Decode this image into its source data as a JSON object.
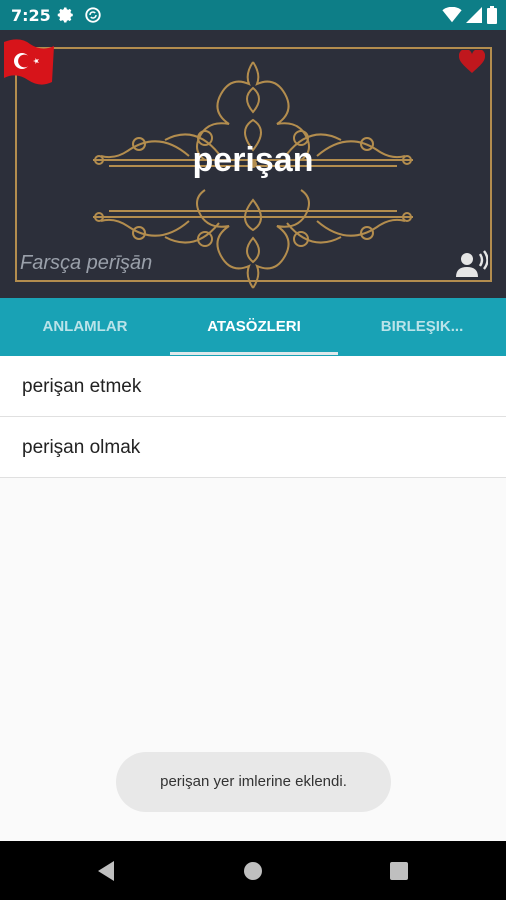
{
  "status_bar": {
    "time": "7:25"
  },
  "header": {
    "word": "perişan",
    "origin": "Farsça perīşān",
    "colors": {
      "background": "#2c2f3a",
      "gold": "#b38d4e",
      "heart": "#c0171d"
    }
  },
  "tabs": [
    {
      "label": "ANLAMLAR",
      "active": false
    },
    {
      "label": "ATASÖZLERI",
      "active": true
    },
    {
      "label": "BIRLEŞIK...",
      "active": false
    }
  ],
  "list": [
    {
      "text": "perişan etmek"
    },
    {
      "text": "perişan olmak"
    }
  ],
  "toast": {
    "text": "perişan yer imlerine eklendi."
  },
  "icons": {
    "status": [
      "gear-icon",
      "sync-icon",
      "wifi-icon",
      "signal-icon",
      "battery-icon"
    ],
    "header": [
      "turkish-flag-icon",
      "heart-icon",
      "speaker-icon"
    ],
    "nav": [
      "back-icon",
      "home-icon",
      "recent-apps-icon"
    ]
  },
  "colors": {
    "status_bar": "#0d7e87",
    "tabs": "#19a2b5",
    "accent_text": "#ffffff"
  }
}
